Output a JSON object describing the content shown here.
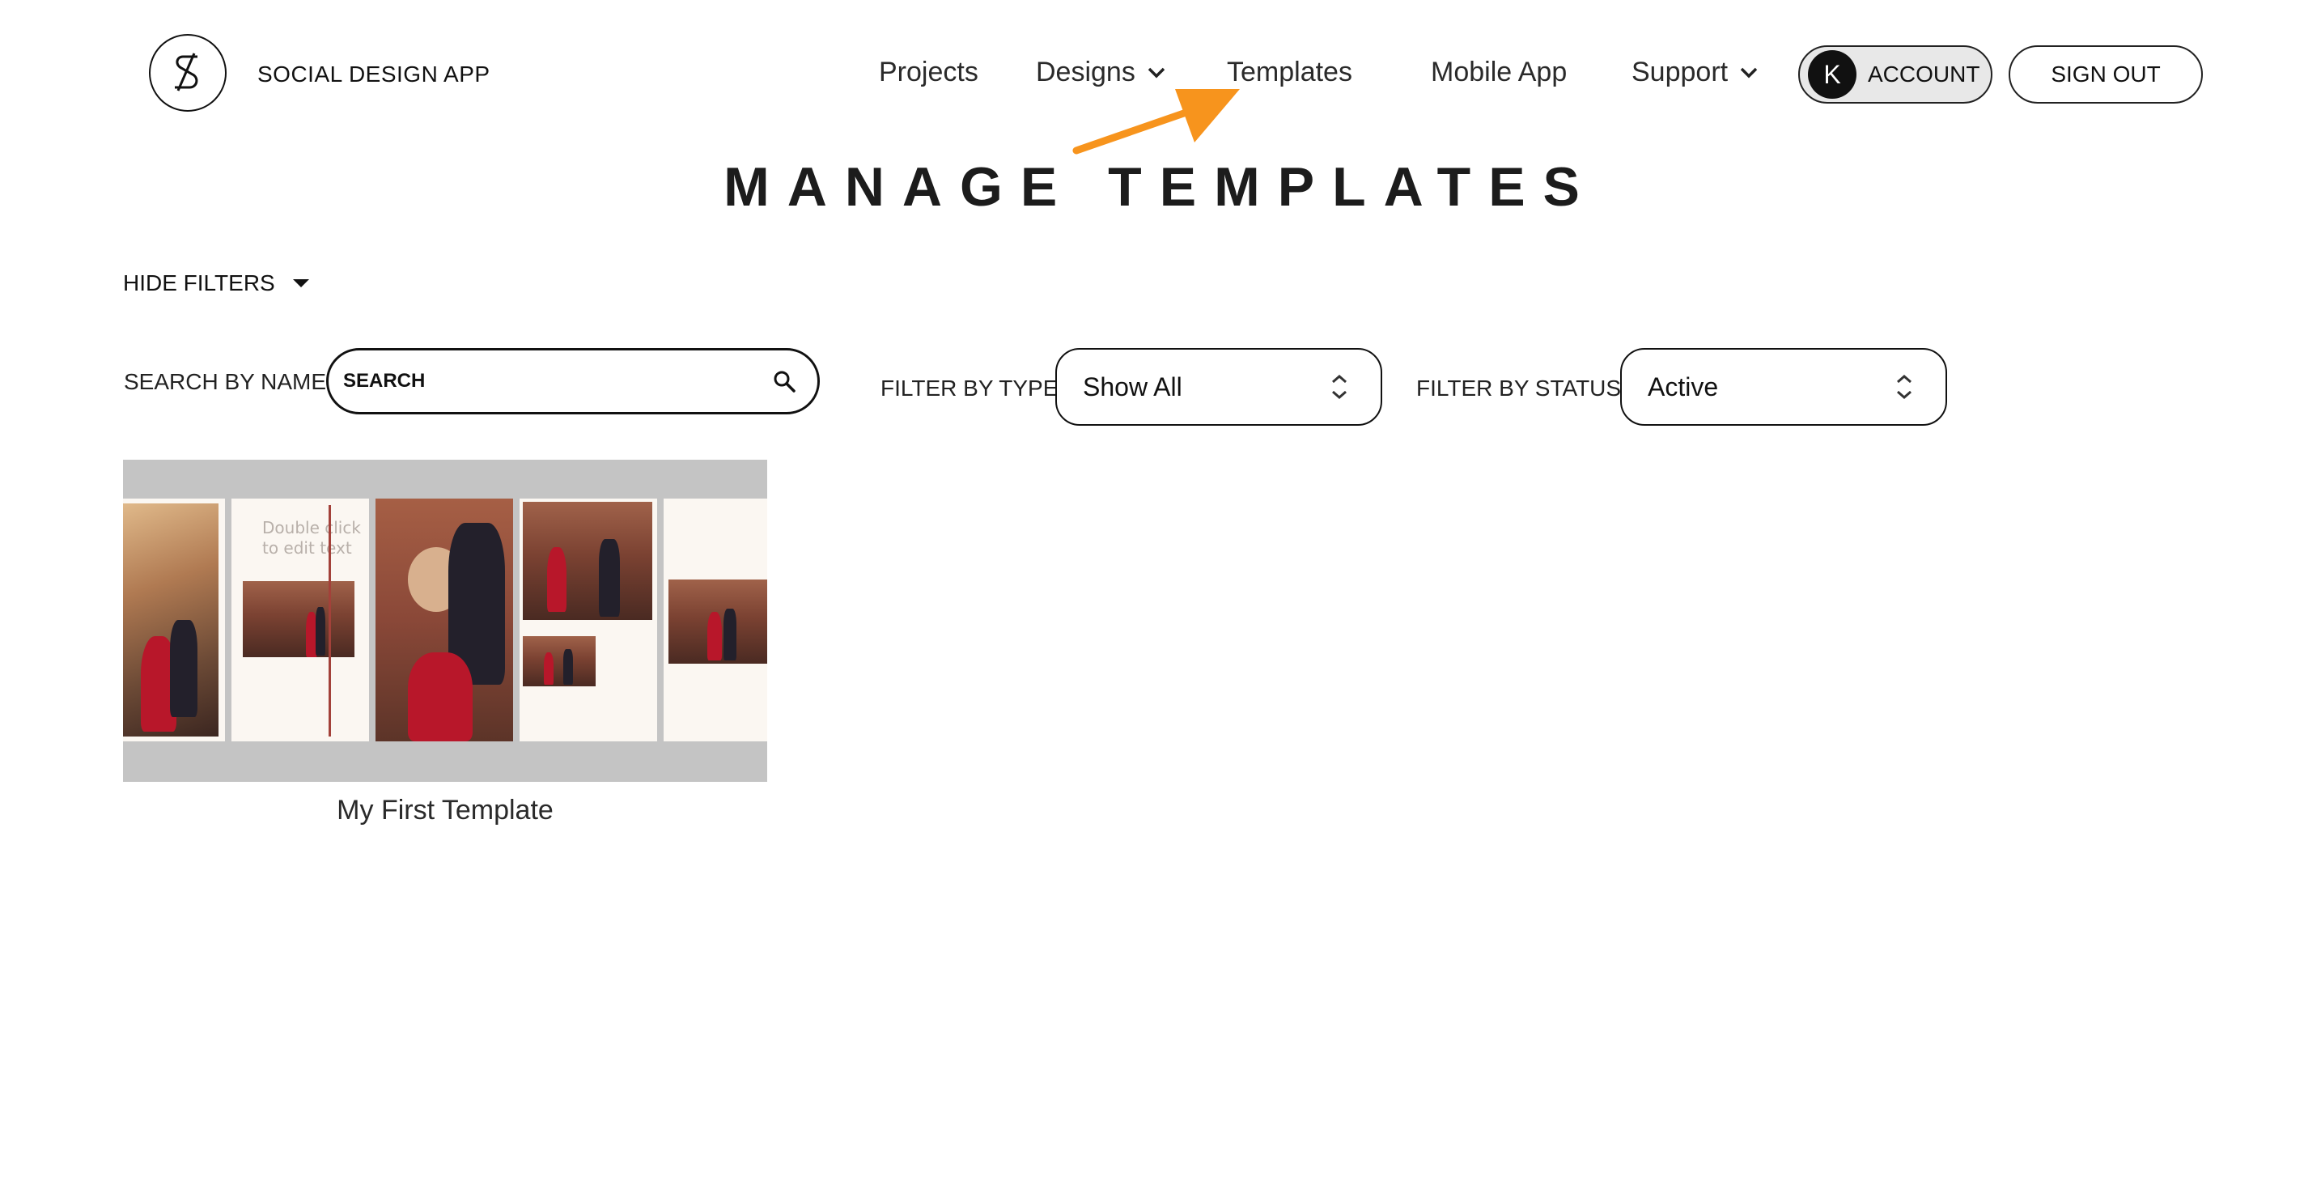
{
  "header": {
    "app_name": "SOCIAL DESIGN APP",
    "nav": {
      "projects": "Projects",
      "designs": "Designs",
      "templates": "Templates",
      "mobile_app": "Mobile App",
      "support": "Support"
    },
    "account": {
      "avatar_initial": "K",
      "label": "ACCOUNT"
    },
    "sign_out": "SIGN OUT"
  },
  "page": {
    "title": "MANAGE TEMPLATES"
  },
  "filters": {
    "toggle_label": "HIDE FILTERS",
    "search": {
      "label": "SEARCH BY NAME",
      "placeholder": "SEARCH"
    },
    "type": {
      "label": "FILTER BY TYPE",
      "value": "Show All"
    },
    "status": {
      "label": "FILTER BY STATUS",
      "value": "Active"
    }
  },
  "templates": [
    {
      "name": "My First Template",
      "preview_overlay_text": "Double click to edit text"
    }
  ],
  "colors": {
    "annotation_arrow": "#f7941d",
    "thumbnail_background": "#c4c4c4",
    "dress_red": "#b8172a"
  },
  "icons": {
    "logo": "logo-s-icon",
    "designs_dropdown": "chevron-down-icon",
    "support_dropdown": "chevron-down-icon",
    "filters_toggle": "caret-down-icon",
    "search": "search-icon",
    "select_arrows": "updown-icon"
  }
}
